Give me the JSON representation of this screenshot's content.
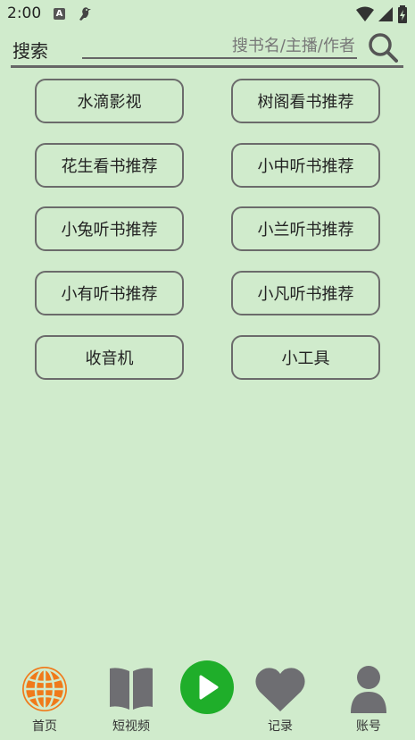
{
  "status_bar": {
    "time": "2:00",
    "a_icon_letter": "A",
    "icons": [
      "a-app-icon",
      "bird-icon",
      "wifi-icon",
      "signal-icon",
      "battery-icon"
    ]
  },
  "search": {
    "label": "搜索",
    "placeholder": "搜书名/主播/作者",
    "icon": "search-icon"
  },
  "buttons": [
    {
      "label": "水滴影视"
    },
    {
      "label": "树阁看书推荐"
    },
    {
      "label": "花生看书推荐"
    },
    {
      "label": "小中听书推荐"
    },
    {
      "label": "小兔听书推荐"
    },
    {
      "label": "小兰听书推荐"
    },
    {
      "label": "小有听书推荐"
    },
    {
      "label": "小凡听书推荐"
    },
    {
      "label": "收音机"
    },
    {
      "label": "小工具"
    }
  ],
  "bottom_nav": {
    "items": [
      {
        "label": "首页",
        "icon": "globe-icon"
      },
      {
        "label": "短视频",
        "icon": "book-icon"
      },
      {
        "label": "",
        "icon": "play-icon"
      },
      {
        "label": "记录",
        "icon": "heart-icon"
      },
      {
        "label": "账号",
        "icon": "person-icon"
      }
    ]
  },
  "colors": {
    "background": "#d0ebcc",
    "accent_orange": "#f07a1a",
    "play_green": "#1fae2a",
    "icon_gray": "#6e6e72"
  }
}
